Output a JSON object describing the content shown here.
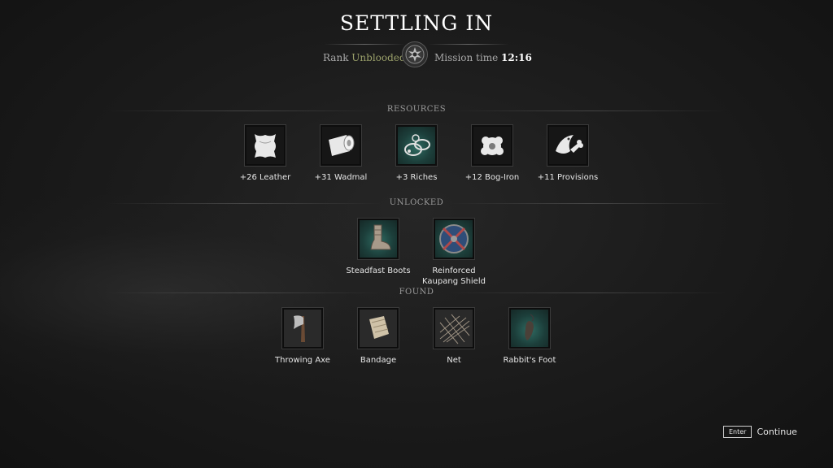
{
  "header": {
    "title": "SETTLING IN",
    "rank_label": "Rank",
    "rank_value": "Unblooded",
    "time_label": "Mission time",
    "time_value": "12:16"
  },
  "sections": {
    "resources": {
      "label": "RESOURCES",
      "items": [
        {
          "label": "+26 Leather",
          "icon": "leather-icon"
        },
        {
          "label": "+31 Wadmal",
          "icon": "wadmal-icon"
        },
        {
          "label": "+3 Riches",
          "icon": "riches-icon"
        },
        {
          "label": "+12 Bog-Iron",
          "icon": "bog-iron-icon"
        },
        {
          "label": "+11 Provisions",
          "icon": "provisions-icon"
        }
      ]
    },
    "unlocked": {
      "label": "UNLOCKED",
      "items": [
        {
          "label": "Steadfast Boots",
          "icon": "boots-icon"
        },
        {
          "label_line1": "Reinforced",
          "label_line2": "Kaupang Shield",
          "icon": "shield-icon"
        }
      ]
    },
    "found": {
      "label": "FOUND",
      "items": [
        {
          "label": "Throwing Axe",
          "icon": "axe-icon"
        },
        {
          "label": "Bandage",
          "icon": "bandage-icon"
        },
        {
          "label": "Net",
          "icon": "net-icon"
        },
        {
          "label": "Rabbit's Foot",
          "icon": "rabbits-foot-icon"
        }
      ]
    }
  },
  "footer": {
    "key_label": "Enter",
    "action_label": "Continue"
  },
  "colors": {
    "rank_accent": "#9aa06a",
    "teal_icon_bg": "#2f6b62"
  }
}
